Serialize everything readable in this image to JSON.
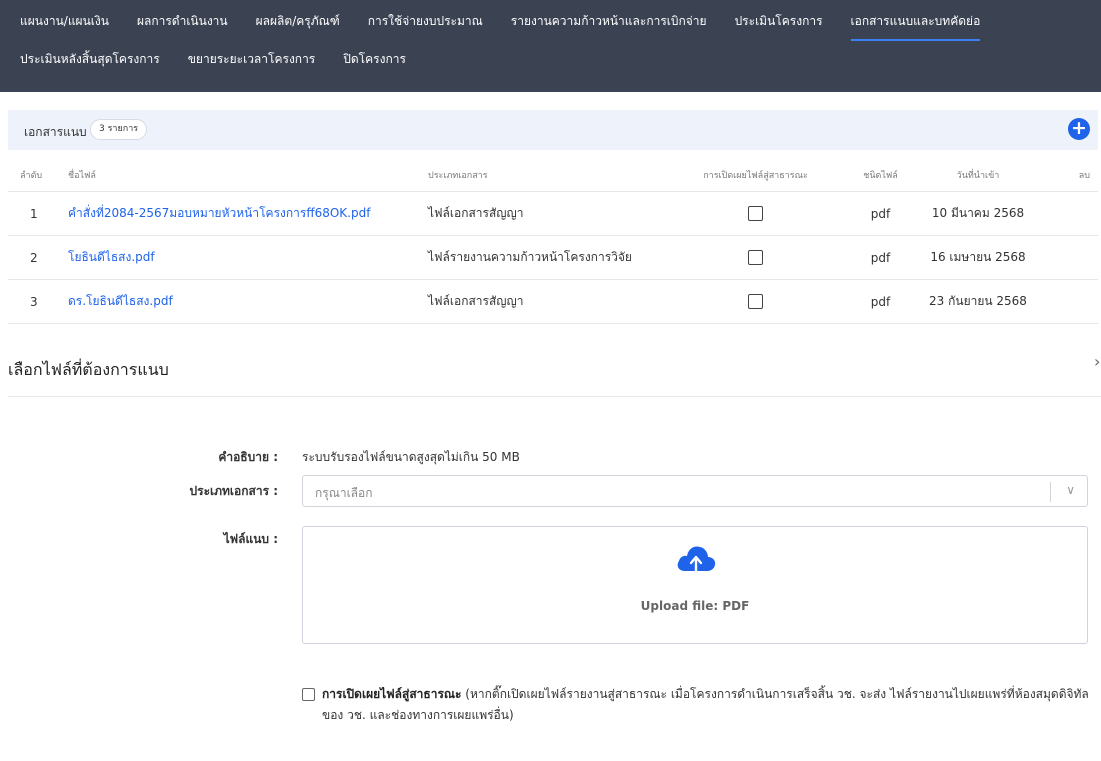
{
  "nav": {
    "row1": [
      "แผนงาน/แผนเงิน",
      "ผลการดำเนินงาน",
      "ผลผลิต/ครุภัณฑ์",
      "การใช้จ่ายงบประมาณ",
      "รายงานความก้าวหน้าและการเบิกจ่าย",
      "ประเมินโครงการ",
      "เอกสารแนบและบทคัดย่อ"
    ],
    "row2": [
      "ประเมินหลังสิ้นสุดโครงการ",
      "ขยายระยะเวลาโครงการ",
      "ปิดโครงการ"
    ],
    "active": "เอกสารแนบและบทคัดย่อ",
    "accent_color": "#3b82f6"
  },
  "attachments": {
    "title": "เอกสารแนบ",
    "count_badge": "3 รายการ",
    "add_icon": "plus-circle-icon",
    "columns": {
      "no": "ลำดับ",
      "name": "ชื่อไฟล์",
      "type": "ประเภทเอกสาร",
      "public": "การเปิดเผยไฟล์สู่สาธารณะ",
      "ext": "ชนิดไฟล์",
      "date": "วันที่นำเข้า",
      "delete": "ลบ"
    },
    "rows": [
      {
        "no": "1",
        "name": "คำสั่งที่2084-2567มอบหมายหัวหน้าโครงการff68OK.pdf",
        "type": "ไฟล์เอกสารสัญญา",
        "public": false,
        "ext": "pdf",
        "date": "10 มีนาคม 2568"
      },
      {
        "no": "2",
        "name": "โยธินดีไธสง.pdf",
        "type": "ไฟล์รายงานความก้าวหน้าโครงการวิจัย",
        "public": false,
        "ext": "pdf",
        "date": "16 เมษายน 2568"
      },
      {
        "no": "3",
        "name": "ดร.โยธินดีไธสง.pdf",
        "type": "ไฟล์เอกสารสัญญา",
        "public": false,
        "ext": "pdf",
        "date": "23 กันยายน 2568"
      }
    ]
  },
  "upload_form": {
    "section_title": "เลือกไฟล์ที่ต้องการแนบ",
    "desc_label": "คำอธิบาย :",
    "desc_value": "ระบบรับรองไฟล์ขนาดสูงสุดไม่เกิน 50 MB",
    "doc_type_label": "ประเภทเอกสาร :",
    "doc_type_placeholder": "กรุณาเลือก",
    "file_label": "ไฟล์แนบ :",
    "upload_text": "Upload file: PDF",
    "upload_icon": "cloud-upload-icon",
    "public_label": "การเปิดเผยไฟล์สู่สาธารณะ",
    "public_note": " (หากติ๊กเปิดเผยไฟล์รายงานสู่สาธารณะ เมื่อโครงการดำเนินการเสร็จสิ้น วช. จะส่ง ไฟล์รายงานไปเผยแพร่ที่ห้องสมุดดิจิทัลของ วช. และช่องทางการเผยแพร่อื่น)",
    "public_checked": false
  }
}
